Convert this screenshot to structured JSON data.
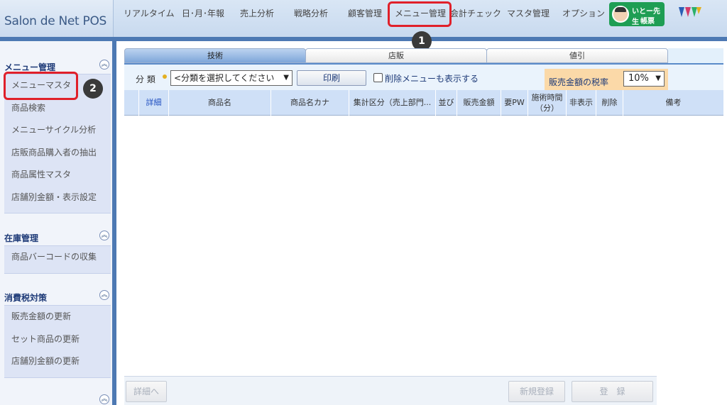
{
  "app": {
    "logo": "Salon de Net POS"
  },
  "nav": {
    "items": [
      "リアルタイム",
      "日･月･年報",
      "売上分析",
      "戦略分析",
      "顧客管理",
      "メニュー管理",
      "会計チェック",
      "マスタ管理",
      "オプション"
    ]
  },
  "user": {
    "line1": "いとー先生",
    "line2": "帳票"
  },
  "annotations": {
    "badge1": "1",
    "badge2": "2"
  },
  "sidebar": {
    "sections": [
      {
        "title": "メニュー管理",
        "items": [
          "メニューマスタ",
          "商品検索",
          "メニューサイクル分析",
          "店販商品購入者の抽出",
          "商品属性マスタ",
          "店舗別金額・表示設定"
        ]
      },
      {
        "title": "在庫管理",
        "items": [
          "商品バーコードの収集"
        ]
      },
      {
        "title": "消費税対策",
        "items": [
          "販売金額の更新",
          "セット商品の更新",
          "店舗別金額の更新"
        ]
      }
    ],
    "collapse_glyph": "︽"
  },
  "tabs": [
    "技術",
    "店販",
    "値引"
  ],
  "toolbar": {
    "category_label": "分 類",
    "category_select": "<分類を選択してください",
    "print_button": "印刷",
    "show_deleted_label": "削除メニューも表示する",
    "tax_label": "販売金額の税率",
    "tax_value": "10%"
  },
  "table": {
    "columns": [
      "",
      "詳細",
      "商品名",
      "商品名カナ",
      "集計区分（売上部門...",
      "並び",
      "販売金額",
      "要PW",
      "施術時間（分）",
      "非表示",
      "削除",
      "備考"
    ],
    "rows": []
  },
  "footer": {
    "detail_button": "詳細へ",
    "new_button": "新規登録",
    "register_button": "登　録"
  }
}
